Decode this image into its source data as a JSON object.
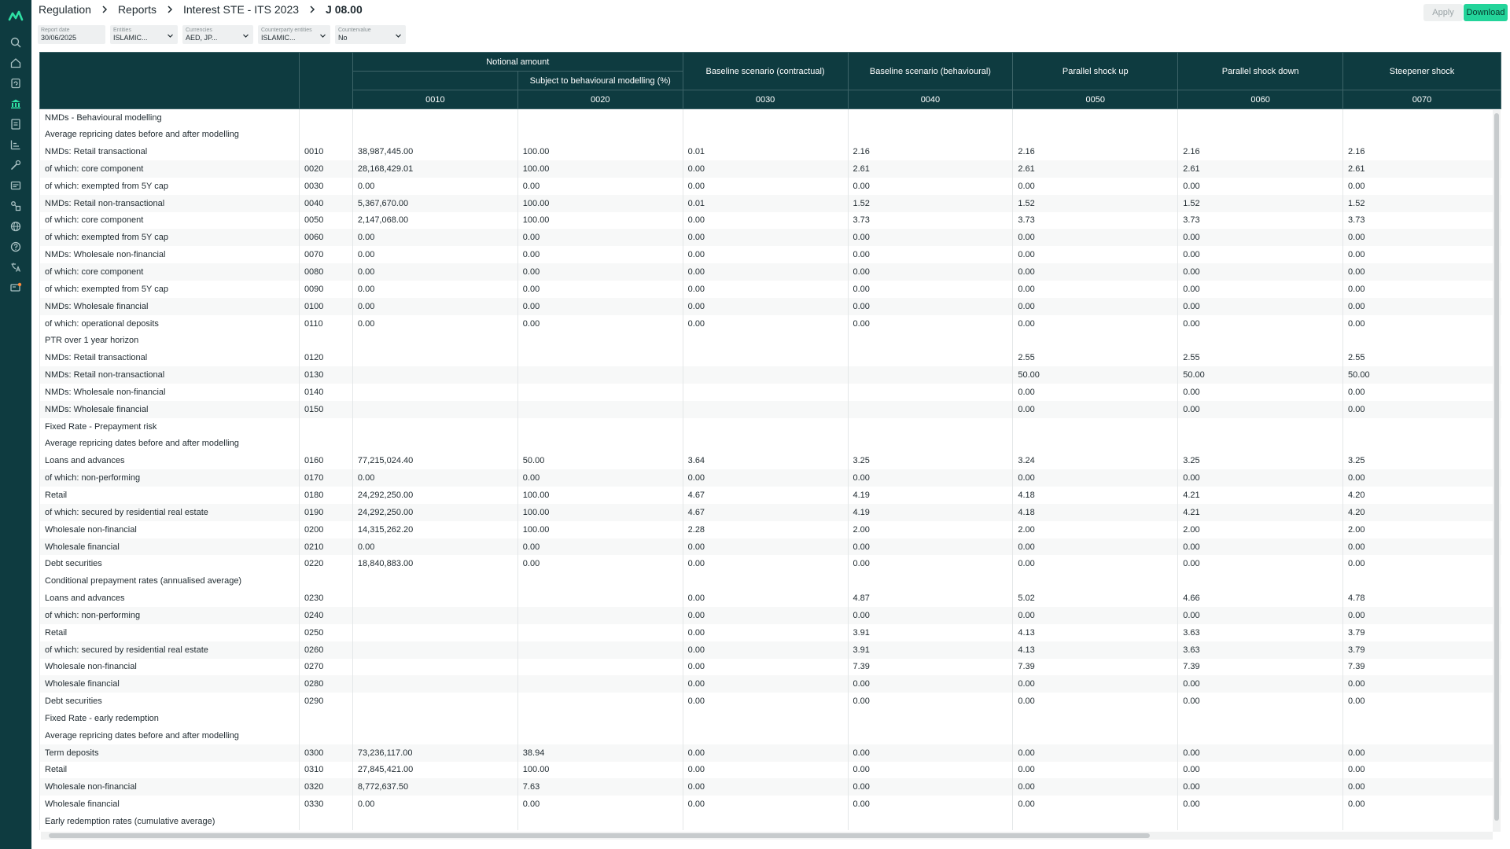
{
  "breadcrumb": [
    "Regulation",
    "Reports",
    "Interest STE - ITS 2023",
    "J 08.00"
  ],
  "actions": {
    "apply": "Apply",
    "download": "Download"
  },
  "filters": [
    {
      "label": "Report date",
      "value": "30/06/2025"
    },
    {
      "label": "Entities",
      "value": "ISLAMIC..."
    },
    {
      "label": "Currencies",
      "value": "AED, JP..."
    },
    {
      "label": "Counterparty entities",
      "value": "ISLAMIC..."
    },
    {
      "label": "Countervalue",
      "value": "No"
    }
  ],
  "table": {
    "header": {
      "notional": "Notional amount",
      "subject": "Subject to behavioural modelling (%)",
      "groups": [
        "Baseline scenario (contractual)",
        "Baseline scenario (behavioural)",
        "Parallel shock up",
        "Parallel shock down",
        "Steepener shock"
      ],
      "codes": [
        "0010",
        "0020",
        "0030",
        "0040",
        "0050",
        "0060",
        "0070"
      ]
    },
    "rows": [
      {
        "label": "NMDs - Behavioural modelling",
        "code": "",
        "v": [
          "",
          "",
          "",
          "",
          "",
          "",
          ""
        ]
      },
      {
        "label": "Average repricing dates before and after modelling",
        "code": "",
        "v": [
          "",
          "",
          "",
          "",
          "",
          "",
          ""
        ]
      },
      {
        "label": "NMDs: Retail transactional",
        "code": "0010",
        "v": [
          "38,987,445.00",
          "100.00",
          "0.01",
          "2.16",
          "2.16",
          "2.16",
          "2.16"
        ]
      },
      {
        "label": "of which: core component",
        "code": "0020",
        "v": [
          "28,168,429.01",
          "100.00",
          "0.00",
          "2.61",
          "2.61",
          "2.61",
          "2.61"
        ]
      },
      {
        "label": "of which: exempted from 5Y cap",
        "code": "0030",
        "v": [
          "0.00",
          "0.00",
          "0.00",
          "0.00",
          "0.00",
          "0.00",
          "0.00"
        ]
      },
      {
        "label": "NMDs: Retail non-transactional",
        "code": "0040",
        "v": [
          "5,367,670.00",
          "100.00",
          "0.01",
          "1.52",
          "1.52",
          "1.52",
          "1.52"
        ]
      },
      {
        "label": "of which: core component",
        "code": "0050",
        "v": [
          "2,147,068.00",
          "100.00",
          "0.00",
          "3.73",
          "3.73",
          "3.73",
          "3.73"
        ]
      },
      {
        "label": "of which: exempted from 5Y cap",
        "code": "0060",
        "v": [
          "0.00",
          "0.00",
          "0.00",
          "0.00",
          "0.00",
          "0.00",
          "0.00"
        ]
      },
      {
        "label": "NMDs: Wholesale non-financial",
        "code": "0070",
        "v": [
          "0.00",
          "0.00",
          "0.00",
          "0.00",
          "0.00",
          "0.00",
          "0.00"
        ]
      },
      {
        "label": "of which: core component",
        "code": "0080",
        "v": [
          "0.00",
          "0.00",
          "0.00",
          "0.00",
          "0.00",
          "0.00",
          "0.00"
        ]
      },
      {
        "label": "of which: exempted from 5Y cap",
        "code": "0090",
        "v": [
          "0.00",
          "0.00",
          "0.00",
          "0.00",
          "0.00",
          "0.00",
          "0.00"
        ]
      },
      {
        "label": "NMDs: Wholesale financial",
        "code": "0100",
        "v": [
          "0.00",
          "0.00",
          "0.00",
          "0.00",
          "0.00",
          "0.00",
          "0.00"
        ]
      },
      {
        "label": "of which: operational deposits",
        "code": "0110",
        "v": [
          "0.00",
          "0.00",
          "0.00",
          "0.00",
          "0.00",
          "0.00",
          "0.00"
        ]
      },
      {
        "label": "PTR over 1 year horizon",
        "code": "",
        "v": [
          "",
          "",
          "",
          "",
          "",
          "",
          ""
        ]
      },
      {
        "label": "NMDs: Retail transactional",
        "code": "0120",
        "v": [
          "",
          "",
          "",
          "",
          "2.55",
          "2.55",
          "2.55"
        ]
      },
      {
        "label": "NMDs: Retail non-transactional",
        "code": "0130",
        "v": [
          "",
          "",
          "",
          "",
          "50.00",
          "50.00",
          "50.00"
        ]
      },
      {
        "label": "NMDs: Wholesale non-financial",
        "code": "0140",
        "v": [
          "",
          "",
          "",
          "",
          "0.00",
          "0.00",
          "0.00"
        ]
      },
      {
        "label": "NMDs: Wholesale financial",
        "code": "0150",
        "v": [
          "",
          "",
          "",
          "",
          "0.00",
          "0.00",
          "0.00"
        ]
      },
      {
        "label": "Fixed Rate - Prepayment risk",
        "code": "",
        "v": [
          "",
          "",
          "",
          "",
          "",
          "",
          ""
        ]
      },
      {
        "label": "Average repricing dates before and after modelling",
        "code": "",
        "v": [
          "",
          "",
          "",
          "",
          "",
          "",
          ""
        ]
      },
      {
        "label": "Loans and advances",
        "code": "0160",
        "v": [
          "77,215,024.40",
          "50.00",
          "3.64",
          "3.25",
          "3.24",
          "3.25",
          "3.25"
        ]
      },
      {
        "label": "of which: non-performing",
        "code": "0170",
        "v": [
          "0.00",
          "0.00",
          "0.00",
          "0.00",
          "0.00",
          "0.00",
          "0.00"
        ]
      },
      {
        "label": "Retail",
        "code": "0180",
        "v": [
          "24,292,250.00",
          "100.00",
          "4.67",
          "4.19",
          "4.18",
          "4.21",
          "4.20"
        ]
      },
      {
        "label": "of which: secured by residential real estate",
        "code": "0190",
        "v": [
          "24,292,250.00",
          "100.00",
          "4.67",
          "4.19",
          "4.18",
          "4.21",
          "4.20"
        ]
      },
      {
        "label": "Wholesale non-financial",
        "code": "0200",
        "v": [
          "14,315,262.20",
          "100.00",
          "2.28",
          "2.00",
          "2.00",
          "2.00",
          "2.00"
        ]
      },
      {
        "label": "Wholesale financial",
        "code": "0210",
        "v": [
          "0.00",
          "0.00",
          "0.00",
          "0.00",
          "0.00",
          "0.00",
          "0.00"
        ]
      },
      {
        "label": "Debt securities",
        "code": "0220",
        "v": [
          "18,840,883.00",
          "0.00",
          "0.00",
          "0.00",
          "0.00",
          "0.00",
          "0.00"
        ]
      },
      {
        "label": "Conditional prepayment rates (annualised average)",
        "code": "",
        "v": [
          "",
          "",
          "",
          "",
          "",
          "",
          ""
        ]
      },
      {
        "label": "Loans and advances",
        "code": "0230",
        "v": [
          "",
          "",
          "0.00",
          "4.87",
          "5.02",
          "4.66",
          "4.78"
        ]
      },
      {
        "label": "of which: non-performing",
        "code": "0240",
        "v": [
          "",
          "",
          "0.00",
          "0.00",
          "0.00",
          "0.00",
          "0.00"
        ]
      },
      {
        "label": "Retail",
        "code": "0250",
        "v": [
          "",
          "",
          "0.00",
          "3.91",
          "4.13",
          "3.63",
          "3.79"
        ]
      },
      {
        "label": "of which: secured by residential real estate",
        "code": "0260",
        "v": [
          "",
          "",
          "0.00",
          "3.91",
          "4.13",
          "3.63",
          "3.79"
        ]
      },
      {
        "label": "Wholesale non-financial",
        "code": "0270",
        "v": [
          "",
          "",
          "0.00",
          "7.39",
          "7.39",
          "7.39",
          "7.39"
        ]
      },
      {
        "label": "Wholesale financial",
        "code": "0280",
        "v": [
          "",
          "",
          "0.00",
          "0.00",
          "0.00",
          "0.00",
          "0.00"
        ]
      },
      {
        "label": "Debt securities",
        "code": "0290",
        "v": [
          "",
          "",
          "0.00",
          "0.00",
          "0.00",
          "0.00",
          "0.00"
        ]
      },
      {
        "label": "Fixed Rate - early redemption",
        "code": "",
        "v": [
          "",
          "",
          "",
          "",
          "",
          "",
          ""
        ]
      },
      {
        "label": "Average repricing dates before and after modelling",
        "code": "",
        "v": [
          "",
          "",
          "",
          "",
          "",
          "",
          ""
        ]
      },
      {
        "label": "Term deposits",
        "code": "0300",
        "v": [
          "73,236,117.00",
          "38.94",
          "0.00",
          "0.00",
          "0.00",
          "0.00",
          "0.00"
        ]
      },
      {
        "label": "Retail",
        "code": "0310",
        "v": [
          "27,845,421.00",
          "100.00",
          "0.00",
          "0.00",
          "0.00",
          "0.00",
          "0.00"
        ]
      },
      {
        "label": "Wholesale non-financial",
        "code": "0320",
        "v": [
          "8,772,637.50",
          "7.63",
          "0.00",
          "0.00",
          "0.00",
          "0.00",
          "0.00"
        ]
      },
      {
        "label": "Wholesale financial",
        "code": "0330",
        "v": [
          "0.00",
          "0.00",
          "0.00",
          "0.00",
          "0.00",
          "0.00",
          "0.00"
        ]
      },
      {
        "label": "Early redemption rates (cumulative average)",
        "code": "",
        "v": [
          "",
          "",
          "",
          "",
          "",
          "",
          ""
        ]
      }
    ]
  },
  "colors": {
    "header_bg": "#0e3b40",
    "sidebar_bg": "#0e3b40",
    "download_bg": "#23d49a"
  },
  "sidebar_icons": [
    "logo-icon",
    "search-icon",
    "home-icon",
    "refresh-icon",
    "regulation-icon",
    "reports-icon",
    "chart-icon",
    "tools-icon",
    "inbox-icon",
    "connections-icon",
    "globe-icon",
    "help-icon",
    "translate-icon",
    "notifications-icon"
  ]
}
